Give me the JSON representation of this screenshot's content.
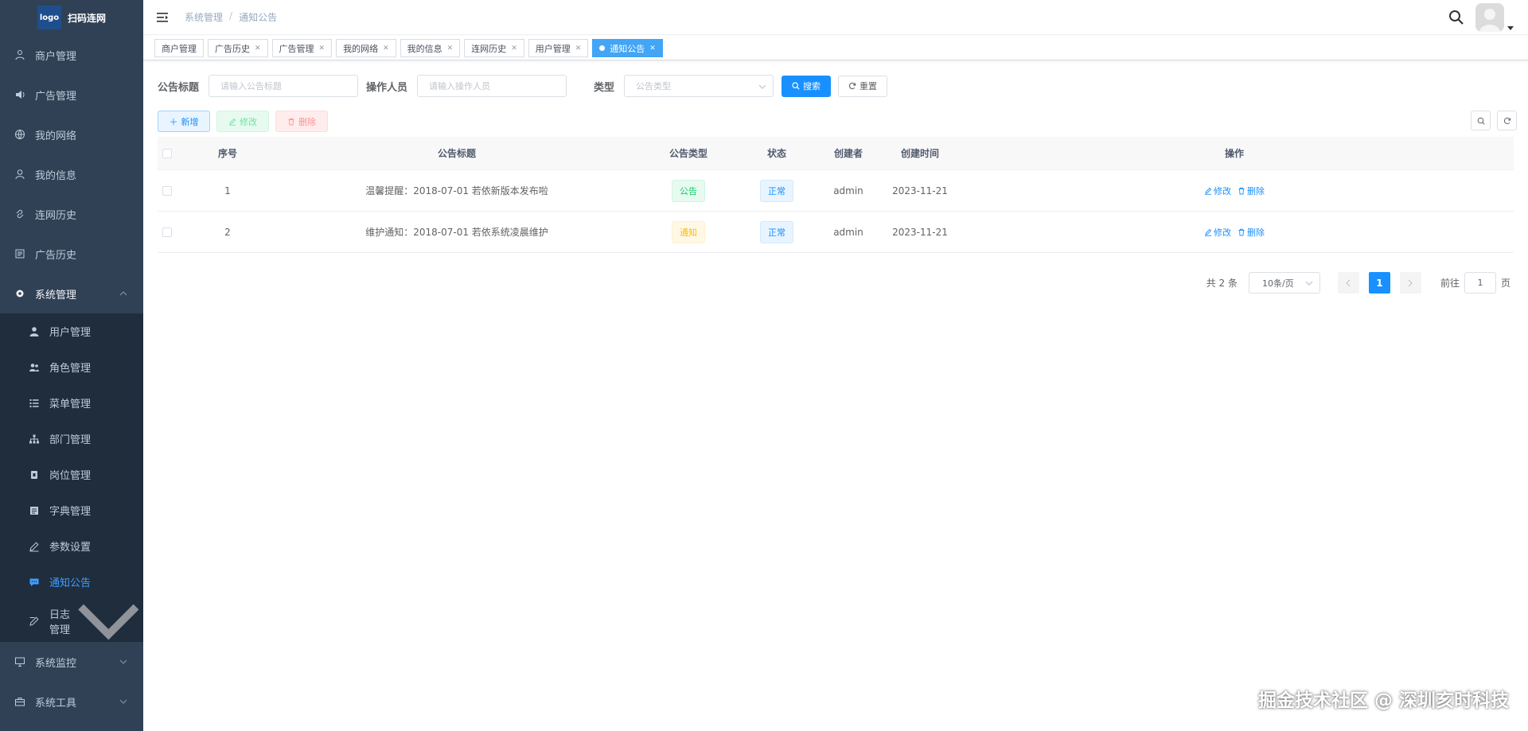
{
  "sidebar": {
    "logo_img_text": "logo",
    "logo_text": "扫码连网",
    "items": [
      {
        "label": "商户管理",
        "icon": "merchant-icon"
      },
      {
        "label": "广告管理",
        "icon": "speaker-icon"
      },
      {
        "label": "我的网络",
        "icon": "globe-icon"
      },
      {
        "label": "我的信息",
        "icon": "user-icon"
      },
      {
        "label": "连网历史",
        "icon": "link-icon"
      },
      {
        "label": "广告历史",
        "icon": "list-icon"
      },
      {
        "label": "系统管理",
        "icon": "gear-icon"
      }
    ],
    "system_sub": [
      {
        "label": "用户管理",
        "icon": "person-icon"
      },
      {
        "label": "角色管理",
        "icon": "people-icon"
      },
      {
        "label": "菜单管理",
        "icon": "tree-list-icon"
      },
      {
        "label": "部门管理",
        "icon": "org-icon"
      },
      {
        "label": "岗位管理",
        "icon": "badge-icon"
      },
      {
        "label": "字典管理",
        "icon": "dict-icon"
      },
      {
        "label": "参数设置",
        "icon": "edit-icon"
      },
      {
        "label": "通知公告",
        "icon": "message-icon"
      },
      {
        "label": "日志管理",
        "icon": "log-icon"
      }
    ],
    "bottom_items": [
      {
        "label": "系统监控",
        "icon": "monitor-icon"
      },
      {
        "label": "系统工具",
        "icon": "toolbox-icon"
      }
    ],
    "active_color": "#409eff",
    "bg_color": "#304156"
  },
  "navbar": {
    "breadcrumb": [
      "系统管理",
      "通知公告"
    ],
    "separator": "/"
  },
  "tags": [
    {
      "label": "商户管理",
      "closable": false,
      "active": false
    },
    {
      "label": "广告历史",
      "closable": true,
      "active": false
    },
    {
      "label": "广告管理",
      "closable": true,
      "active": false
    },
    {
      "label": "我的网络",
      "closable": true,
      "active": false
    },
    {
      "label": "我的信息",
      "closable": true,
      "active": false
    },
    {
      "label": "连网历史",
      "closable": true,
      "active": false
    },
    {
      "label": "用户管理",
      "closable": true,
      "active": false
    },
    {
      "label": "通知公告",
      "closable": true,
      "active": true
    }
  ],
  "search": {
    "title_label": "公告标题",
    "title_placeholder": "请输入公告标题",
    "operator_label": "操作人员",
    "operator_placeholder": "请输入操作人员",
    "type_label": "类型",
    "type_placeholder": "公告类型",
    "search_button": "搜索",
    "reset_button": "重置"
  },
  "toolbar": {
    "add": "新增",
    "edit": "修改",
    "delete": "删除"
  },
  "table": {
    "headers": [
      "序号",
      "公告标题",
      "公告类型",
      "状态",
      "创建者",
      "创建时间",
      "操作"
    ],
    "rows": [
      {
        "index": "1",
        "title": "温馨提醒：2018-07-01 若依新版本发布啦",
        "type": "公告",
        "type_style": "success",
        "status": "正常",
        "creator": "admin",
        "time": "2023-11-21",
        "edit": "修改",
        "delete": "删除"
      },
      {
        "index": "2",
        "title": "维护通知：2018-07-01 若依系统凌晨维护",
        "type": "通知",
        "type_style": "warning",
        "status": "正常",
        "creator": "admin",
        "time": "2023-11-21",
        "edit": "修改",
        "delete": "删除"
      }
    ]
  },
  "pagination": {
    "total": "共 2 条",
    "page_size": "10条/页",
    "current_page": "1",
    "goto_label": "前往",
    "goto_value": "1",
    "page_suffix": "页"
  },
  "watermark": "掘金技术社区 @ 深圳亥时科技"
}
